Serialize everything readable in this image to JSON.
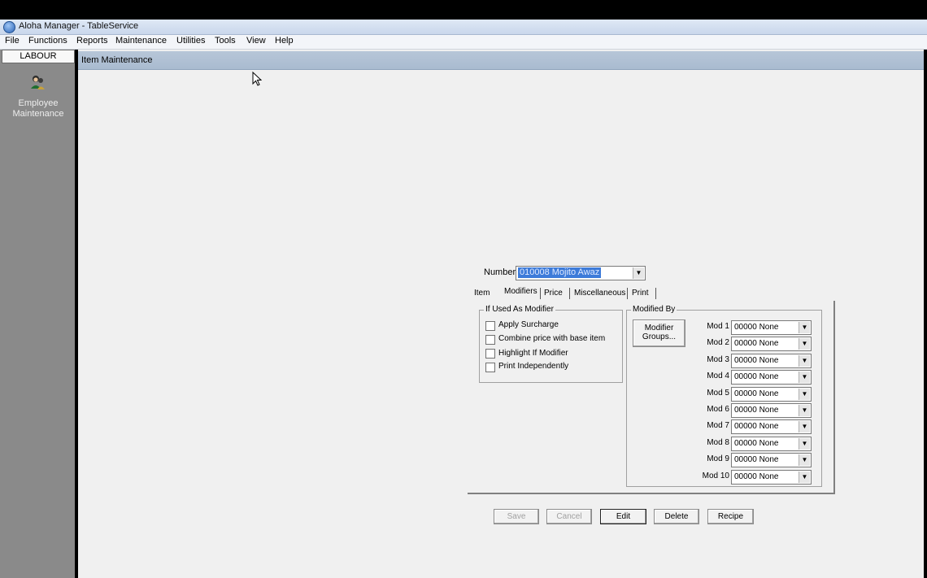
{
  "window": {
    "title": "Aloha Manager - TableService"
  },
  "menu": [
    "File",
    "Functions",
    "Reports",
    "Maintenance",
    "Utilities",
    "Tools",
    "View",
    "Help"
  ],
  "sidebar": {
    "group_button": "LABOUR",
    "items": [
      {
        "icon": "employee-icon",
        "label_line1": "Employee",
        "label_line2": "Maintenance"
      }
    ]
  },
  "main": {
    "header": "Item Maintenance"
  },
  "form": {
    "number_label": "Number:",
    "number_value": "010008 Mojito Awaz",
    "tabs": [
      "Item",
      "Modifiers",
      "Price",
      "Miscellaneous",
      "Print"
    ],
    "active_tab": "Modifiers",
    "if_used_group": {
      "title": "If Used As Modifier",
      "options": [
        {
          "label": "Apply Surcharge",
          "checked": false
        },
        {
          "label": "Combine price with base item",
          "checked": false
        },
        {
          "label": "Highlight If Modifier",
          "checked": false
        },
        {
          "label": "Print Independently",
          "checked": false
        }
      ]
    },
    "modified_by_group": {
      "title": "Modified By",
      "modifier_groups_button_line1": "Modifier",
      "modifier_groups_button_line2": "Groups...",
      "mods": [
        {
          "label": "Mod 1",
          "value": "00000 None"
        },
        {
          "label": "Mod 2",
          "value": "00000 None"
        },
        {
          "label": "Mod 3",
          "value": "00000 None"
        },
        {
          "label": "Mod 4",
          "value": "00000 None"
        },
        {
          "label": "Mod 5",
          "value": "00000 None"
        },
        {
          "label": "Mod 6",
          "value": "00000 None"
        },
        {
          "label": "Mod 7",
          "value": "00000 None"
        },
        {
          "label": "Mod 8",
          "value": "00000 None"
        },
        {
          "label": "Mod 9",
          "value": "00000 None"
        },
        {
          "label": "Mod 10",
          "value": "00000 None"
        }
      ]
    },
    "buttons": {
      "save": "Save",
      "cancel": "Cancel",
      "edit": "Edit",
      "delete": "Delete",
      "recipe": "Recipe"
    }
  }
}
